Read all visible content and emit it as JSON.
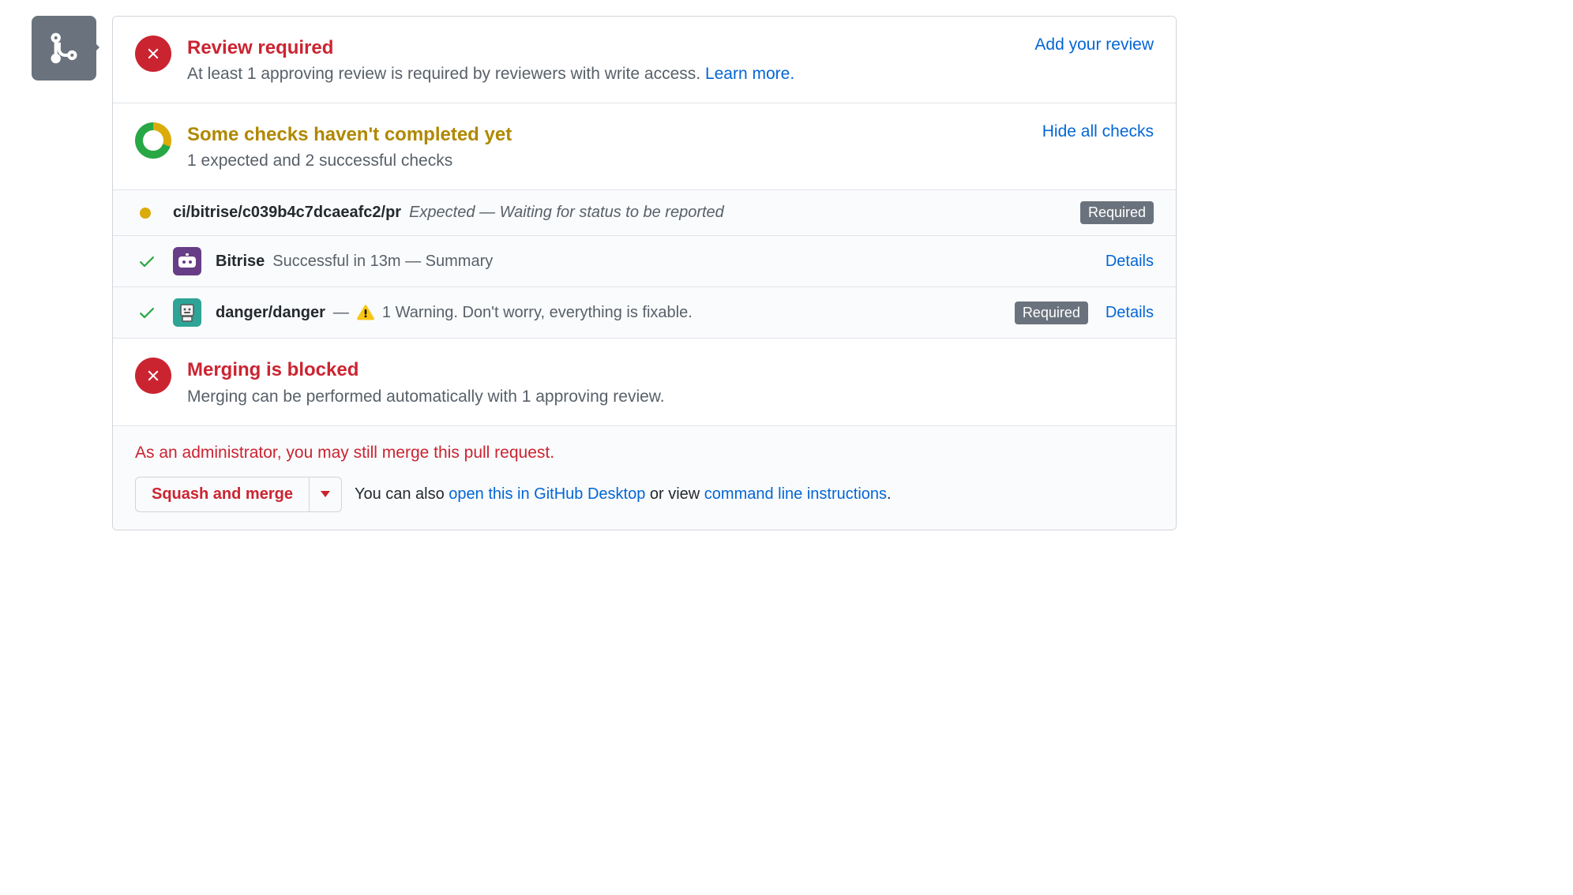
{
  "review": {
    "title": "Review required",
    "description_prefix": "At least 1 approving review is required by reviewers with write access. ",
    "learn_more": "Learn more.",
    "add_review": "Add your review"
  },
  "checks": {
    "title": "Some checks haven't completed yet",
    "summary": "1 expected and 2 successful checks",
    "toggle": "Hide all checks",
    "items": [
      {
        "name": "ci/bitrise/c039b4c7dcaeafc2/pr",
        "status_text": "Expected — Waiting for status to be reported",
        "required": "Required"
      },
      {
        "name": "Bitrise",
        "status_text": "Successful in 13m — Summary",
        "details": "Details"
      },
      {
        "name": "danger/danger",
        "dash": "—",
        "warning_text": "1 Warning. Don't worry, everything is fixable.",
        "required": "Required",
        "details": "Details"
      }
    ]
  },
  "blocked": {
    "title": "Merging is blocked",
    "description": "Merging can be performed automatically with 1 approving review."
  },
  "footer": {
    "admin_note": "As an administrator, you may still merge this pull request.",
    "merge_button": "Squash and merge",
    "hint_prefix": "You can also ",
    "open_desktop": "open this in GitHub Desktop",
    "hint_mid": " or view ",
    "cli_instructions": "command line instructions",
    "hint_suffix": "."
  }
}
